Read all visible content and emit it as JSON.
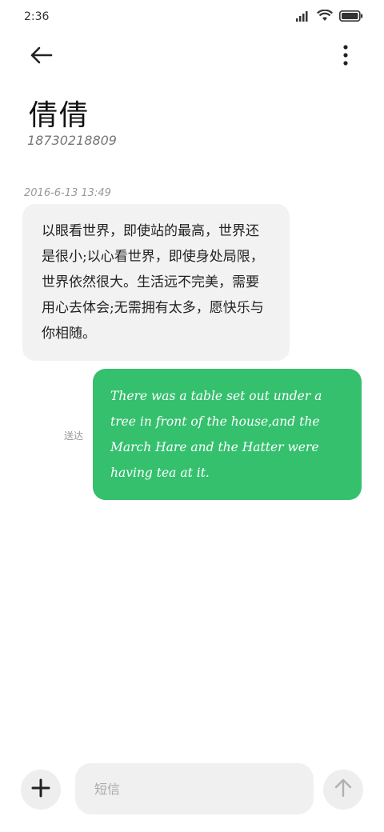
{
  "status_bar": {
    "time": "2:36",
    "icons": [
      "signal-icon",
      "wifi-icon",
      "battery-icon"
    ]
  },
  "app_bar": {
    "back_icon": "back-arrow-icon",
    "more_icon": "more-vertical-icon"
  },
  "contact": {
    "name": "倩倩",
    "number": "18730218809"
  },
  "conversation": {
    "timestamp": "2016-6-13 13:49",
    "messages": [
      {
        "direction": "incoming",
        "text": "以眼看世界，即使站的最高，世界还是很小;以心看世界，即使身处局限，世界依然很大。生活远不完美，需要用心去体会;无需拥有太多，愿快乐与你相随。"
      },
      {
        "direction": "outgoing",
        "text": "There was a table set out under a tree in front of the house,and the March Hare and the Hatter were having tea at it.",
        "status": "送达"
      }
    ]
  },
  "composer": {
    "add_icon": "plus-icon",
    "placeholder": "短信",
    "value": "",
    "send_icon": "send-arrow-up-icon"
  },
  "colors": {
    "outgoing_bubble": "#35c06e",
    "incoming_bubble": "#f2f2f2",
    "background": "#ffffff"
  }
}
